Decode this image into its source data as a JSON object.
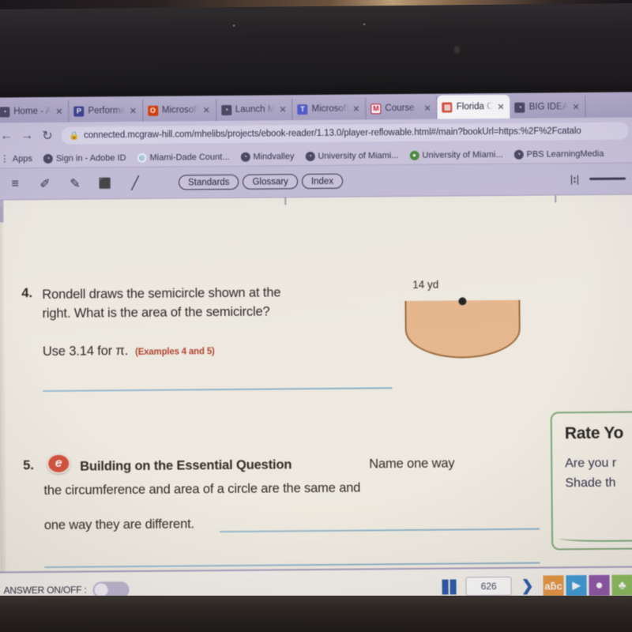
{
  "browser": {
    "tabs": [
      {
        "title": "Home - A",
        "favicon_glyph": "◔",
        "favicon_color": "#4a4560",
        "active": false
      },
      {
        "title": "Performa",
        "favicon_glyph": "P",
        "favicon_color": "#3b3f8f",
        "active": false
      },
      {
        "title": "Microsoft",
        "favicon_glyph": "O",
        "favicon_color": "#d83b01",
        "active": false
      },
      {
        "title": "Launch M",
        "favicon_glyph": "◔",
        "favicon_color": "#4a4560",
        "active": false
      },
      {
        "title": "Microsoft",
        "favicon_glyph": "T",
        "favicon_color": "#5059c9",
        "active": false
      },
      {
        "title": "Course -",
        "favicon_glyph": "M",
        "favicon_color": "#c8102e",
        "active": false
      },
      {
        "title": "Florida C",
        "favicon_glyph": "▤",
        "favicon_color": "#d8503a",
        "active": true
      },
      {
        "title": "BIG IDEA",
        "favicon_glyph": "◔",
        "favicon_color": "#4a4560",
        "active": false
      }
    ],
    "tab_close_glyph": "✕",
    "nav": {
      "back_glyph": "←",
      "forward_glyph": "→",
      "reload_glyph": "↻"
    },
    "omnibox": {
      "lock_glyph": "🔒",
      "url": "connected.mcgraw-hill.com/mhelibs/projects/ebook-reader/1.13.0/player-reflowable.html#/main?bookUrl=https:%2F%2Fcatalo"
    },
    "bookmarks": [
      {
        "label": "Apps",
        "icon": "apps-grid-icon",
        "glyph": "∷"
      },
      {
        "label": "Sign in - Adobe ID",
        "icon": "globe-icon",
        "glyph": "◔"
      },
      {
        "label": "Miami-Dade Count...",
        "icon": "globe-icon",
        "glyph": "◎"
      },
      {
        "label": "Mindvalley",
        "icon": "globe-icon",
        "glyph": "◔"
      },
      {
        "label": "University of Miami...",
        "icon": "globe-icon",
        "glyph": "◔"
      },
      {
        "label": "University of Miami...",
        "icon": "site-icon",
        "glyph": "●"
      },
      {
        "label": "PBS LearningMedia",
        "icon": "globe-icon",
        "glyph": "◔"
      }
    ]
  },
  "reader_toolbar": {
    "tools": [
      {
        "name": "menu-lines-icon",
        "glyph": "≡"
      },
      {
        "name": "highlighter-icon",
        "glyph": "✐"
      },
      {
        "name": "pencil-icon",
        "glyph": "✎"
      },
      {
        "name": "bookmark-icon",
        "glyph": "⬛"
      },
      {
        "name": "pen-line-icon",
        "glyph": "╱"
      }
    ],
    "pills": [
      {
        "label": "Standards"
      },
      {
        "label": "Glossary"
      },
      {
        "label": "Index"
      }
    ],
    "resize_glyph": "|↕|"
  },
  "page": {
    "questions": [
      {
        "number": "4.",
        "line1": "Rondell draws the semicircle shown at the",
        "line2": "right. What is the area of the semicircle?",
        "line3_prefix": "Use 3.14 for ",
        "line3_pi": "π.",
        "examples": "(Examples 4 and 5)"
      },
      {
        "number": "5.",
        "badge_glyph": "e",
        "bold_lead": "Building on the Essential Question",
        "line1_rest": "Name one way",
        "line2": "the circumference and area of a circle are the same and",
        "line3": "one way they are different."
      }
    ],
    "figure": {
      "label": "14 yd",
      "shape": "semicircle",
      "fill_color": "#edbb8f",
      "stroke_color": "#9c6a3b",
      "diameter_highlight_color": "#c96aa0"
    },
    "rate_box": {
      "title": "Rate Yo",
      "line1": "Are you r",
      "line2": "Shade th",
      "border_color": "#7fa877"
    }
  },
  "bottom_bar": {
    "answer_toggle_label": "ANSWER ON/OFF :",
    "answer_toggle_state": "off",
    "spread_icon": "two-page-spread-icon",
    "page_number": "626",
    "next_glyph": "❯",
    "app_icons": [
      {
        "name": "vocab-icon",
        "glyph": "aƃc",
        "color": "#e8973f"
      },
      {
        "name": "video-play-icon",
        "glyph": "▶",
        "color": "#3a9bd9"
      },
      {
        "name": "chat-bubble-icon",
        "glyph": "●",
        "color": "#8e54a8"
      },
      {
        "name": "group-people-icon",
        "glyph": "♣",
        "color": "#8bbf5a"
      }
    ]
  }
}
